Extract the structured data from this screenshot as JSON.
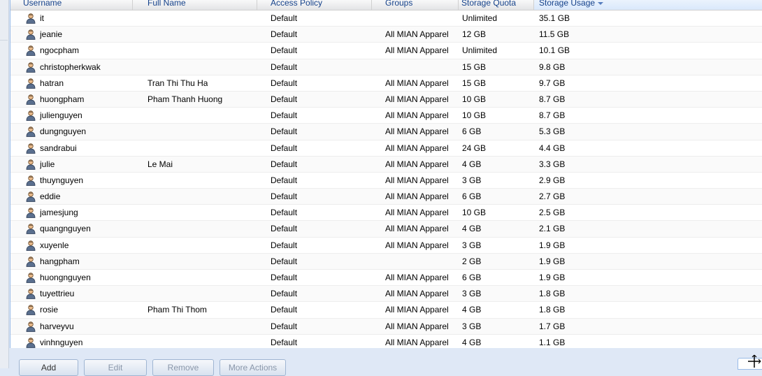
{
  "columns": {
    "username": "Username",
    "full_name": "Full Name",
    "access_policy": "Access Policy",
    "groups": "Groups",
    "storage_quota": "Storage Quota",
    "storage_usage": "Storage Usage"
  },
  "sort": {
    "column": "storage_usage",
    "direction": "descending"
  },
  "rows": [
    {
      "username": "it",
      "full_name": "",
      "access_policy": "Default",
      "groups": "",
      "storage_quota": "Unlimited",
      "storage_usage": "35.1 GB"
    },
    {
      "username": "jeanie",
      "full_name": "",
      "access_policy": "Default",
      "groups": "All MIAN Apparel",
      "storage_quota": "12 GB",
      "storage_usage": "11.5 GB"
    },
    {
      "username": "ngocpham",
      "full_name": "",
      "access_policy": "Default",
      "groups": "All MIAN Apparel",
      "storage_quota": "Unlimited",
      "storage_usage": "10.1 GB"
    },
    {
      "username": "christopherkwak",
      "full_name": "",
      "access_policy": "Default",
      "groups": "",
      "storage_quota": "15 GB",
      "storage_usage": "9.8 GB"
    },
    {
      "username": "hatran",
      "full_name": "Tran Thi Thu Ha",
      "access_policy": "Default",
      "groups": "All MIAN Apparel",
      "storage_quota": "15 GB",
      "storage_usage": "9.7 GB"
    },
    {
      "username": "huongpham",
      "full_name": "Pham Thanh Huong",
      "access_policy": "Default",
      "groups": "All MIAN Apparel",
      "storage_quota": "10 GB",
      "storage_usage": "8.7 GB"
    },
    {
      "username": "julienguyen",
      "full_name": "",
      "access_policy": "Default",
      "groups": "All MIAN Apparel",
      "storage_quota": "10 GB",
      "storage_usage": "8.7 GB"
    },
    {
      "username": "dungnguyen",
      "full_name": "",
      "access_policy": "Default",
      "groups": "All MIAN Apparel",
      "storage_quota": "6 GB",
      "storage_usage": "5.3 GB"
    },
    {
      "username": "sandrabui",
      "full_name": "",
      "access_policy": "Default",
      "groups": "All MIAN Apparel",
      "storage_quota": "24 GB",
      "storage_usage": "4.4 GB"
    },
    {
      "username": "julie",
      "full_name": "Le Mai",
      "access_policy": "Default",
      "groups": "All MIAN Apparel",
      "storage_quota": "4 GB",
      "storage_usage": "3.3 GB"
    },
    {
      "username": "thuynguyen",
      "full_name": "",
      "access_policy": "Default",
      "groups": "All MIAN Apparel",
      "storage_quota": "3 GB",
      "storage_usage": "2.9 GB"
    },
    {
      "username": "eddie",
      "full_name": "",
      "access_policy": "Default",
      "groups": "All MIAN Apparel",
      "storage_quota": "6 GB",
      "storage_usage": "2.7 GB"
    },
    {
      "username": "jamesjung",
      "full_name": "",
      "access_policy": "Default",
      "groups": "All MIAN Apparel",
      "storage_quota": "10 GB",
      "storage_usage": "2.5 GB"
    },
    {
      "username": "quangnguyen",
      "full_name": "",
      "access_policy": "Default",
      "groups": "All MIAN Apparel",
      "storage_quota": "4 GB",
      "storage_usage": "2.1 GB"
    },
    {
      "username": "xuyenle",
      "full_name": "",
      "access_policy": "Default",
      "groups": "All MIAN Apparel",
      "storage_quota": "3 GB",
      "storage_usage": "1.9 GB"
    },
    {
      "username": "hangpham",
      "full_name": "",
      "access_policy": "Default",
      "groups": "",
      "storage_quota": "2 GB",
      "storage_usage": "1.9 GB"
    },
    {
      "username": "huongnguyen",
      "full_name": "",
      "access_policy": "Default",
      "groups": "All MIAN Apparel",
      "storage_quota": "6 GB",
      "storage_usage": "1.9 GB"
    },
    {
      "username": "tuyettrieu",
      "full_name": "",
      "access_policy": "Default",
      "groups": "All MIAN Apparel",
      "storage_quota": "3 GB",
      "storage_usage": "1.8 GB"
    },
    {
      "username": "rosie",
      "full_name": "Pham Thi Thom",
      "access_policy": "Default",
      "groups": "All MIAN Apparel",
      "storage_quota": "4 GB",
      "storage_usage": "1.8 GB"
    },
    {
      "username": "harveyvu",
      "full_name": "",
      "access_policy": "Default",
      "groups": "All MIAN Apparel",
      "storage_quota": "3 GB",
      "storage_usage": "1.7 GB"
    },
    {
      "username": "vinhnguyen",
      "full_name": "",
      "access_policy": "Default",
      "groups": "All MIAN Apparel",
      "storage_quota": "4 GB",
      "storage_usage": "1.1 GB"
    }
  ],
  "toolbar": {
    "add_label": "Add",
    "edit_label": "Edit",
    "remove_label": "Remove",
    "more_actions_label": "More Actions"
  },
  "icons": {
    "user": "user-icon",
    "sort": "sort-descending-icon",
    "cursor": "resize-cursor-icon"
  },
  "colors": {
    "header_text": "#15428b",
    "border": "#99bbe8",
    "icon_body": "#5a6f8e",
    "icon_face": "#e8b98a"
  }
}
